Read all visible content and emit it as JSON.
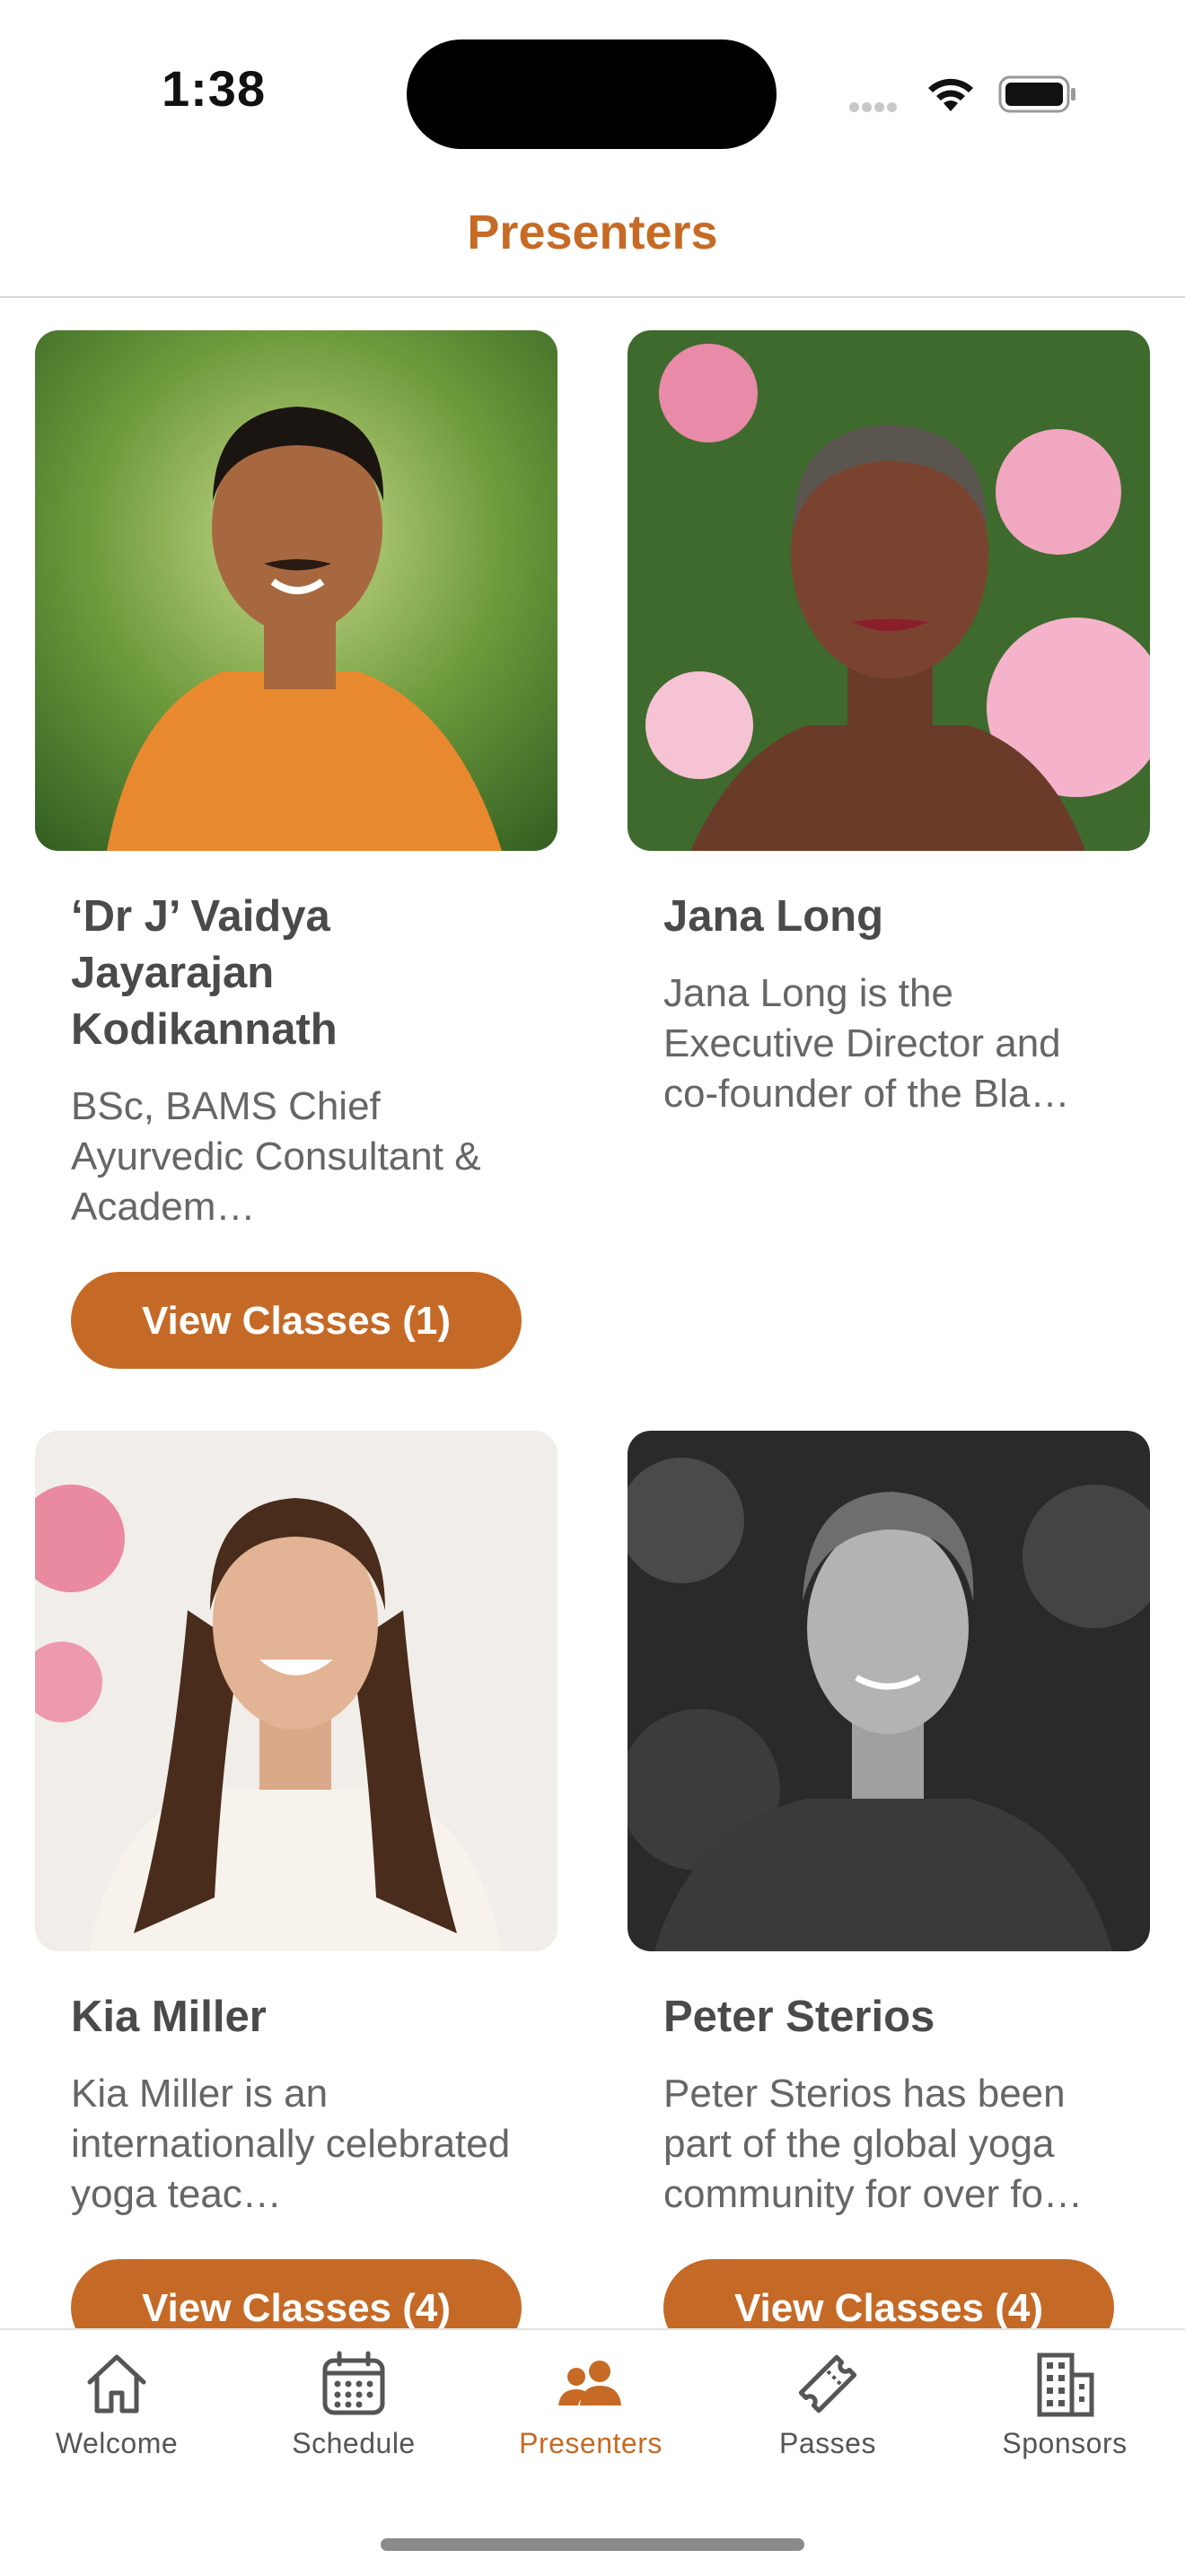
{
  "status_bar": {
    "time": "1:38"
  },
  "header": {
    "title": "Presenters"
  },
  "presenters": [
    {
      "name": "‘Dr J’ Vaidya Jayarajan Kodikannath",
      "bio": "BSc, BAMS Chief Ayurvedic Consultant & Academ…",
      "button_label": "View Classes (1)"
    },
    {
      "name": "Jana Long",
      "bio": "Jana Long is the Executive Director and co-founder of the Bla…",
      "button_label": ""
    },
    {
      "name": "Kia Miller",
      "bio": "Kia Miller is an internationally celebrated yoga teac…",
      "button_label": "View Classes (4)"
    },
    {
      "name": "Peter Sterios",
      "bio": "Peter Sterios has been part of the global yoga community for over fo…",
      "button_label": "View Classes (4)"
    }
  ],
  "tabs": [
    {
      "label": "Welcome",
      "icon": "house-icon"
    },
    {
      "label": "Schedule",
      "icon": "calendar-icon"
    },
    {
      "label": "Presenters",
      "icon": "people-icon",
      "active": true
    },
    {
      "label": "Passes",
      "icon": "ticket-icon"
    },
    {
      "label": "Sponsors",
      "icon": "building-icon"
    }
  ],
  "colors": {
    "accent": "#c66a25",
    "button": "#c56a26"
  }
}
